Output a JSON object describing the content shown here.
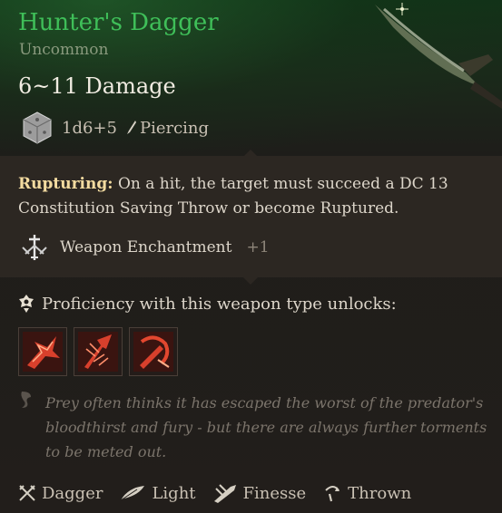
{
  "item": {
    "name": "Hunter's Dagger",
    "rarity": "Uncommon",
    "damage": "6~11 Damage",
    "dice": "1d6+5",
    "damage_type": "Piercing"
  },
  "properties": {
    "rupturing_label": "Rupturing:",
    "rupturing_text": "On a hit, the target must succeed a  DC 13 Constitution Saving Throw or become Ruptured.",
    "enchantment_label": "Weapon Enchantment",
    "enchantment_bonus": "+1"
  },
  "proficiency": {
    "label": "Proficiency with this weapon type unlocks:",
    "actions": [
      "action-1",
      "action-2",
      "action-3"
    ]
  },
  "flavor_text": "Prey often thinks it has escaped the worst of the predator's bloodthirst and fury - but there are always further torments to be meted out.",
  "tags": [
    {
      "label": "Dagger",
      "icon": "crossed-blades-icon"
    },
    {
      "label": "Light",
      "icon": "feather-icon"
    },
    {
      "label": "Finesse",
      "icon": "finesse-icon"
    },
    {
      "label": "Thrown",
      "icon": "thrown-icon"
    }
  ],
  "colors": {
    "title": "#3fbf59",
    "highlight": "#f3dba0",
    "action_red": "#e0452e"
  }
}
